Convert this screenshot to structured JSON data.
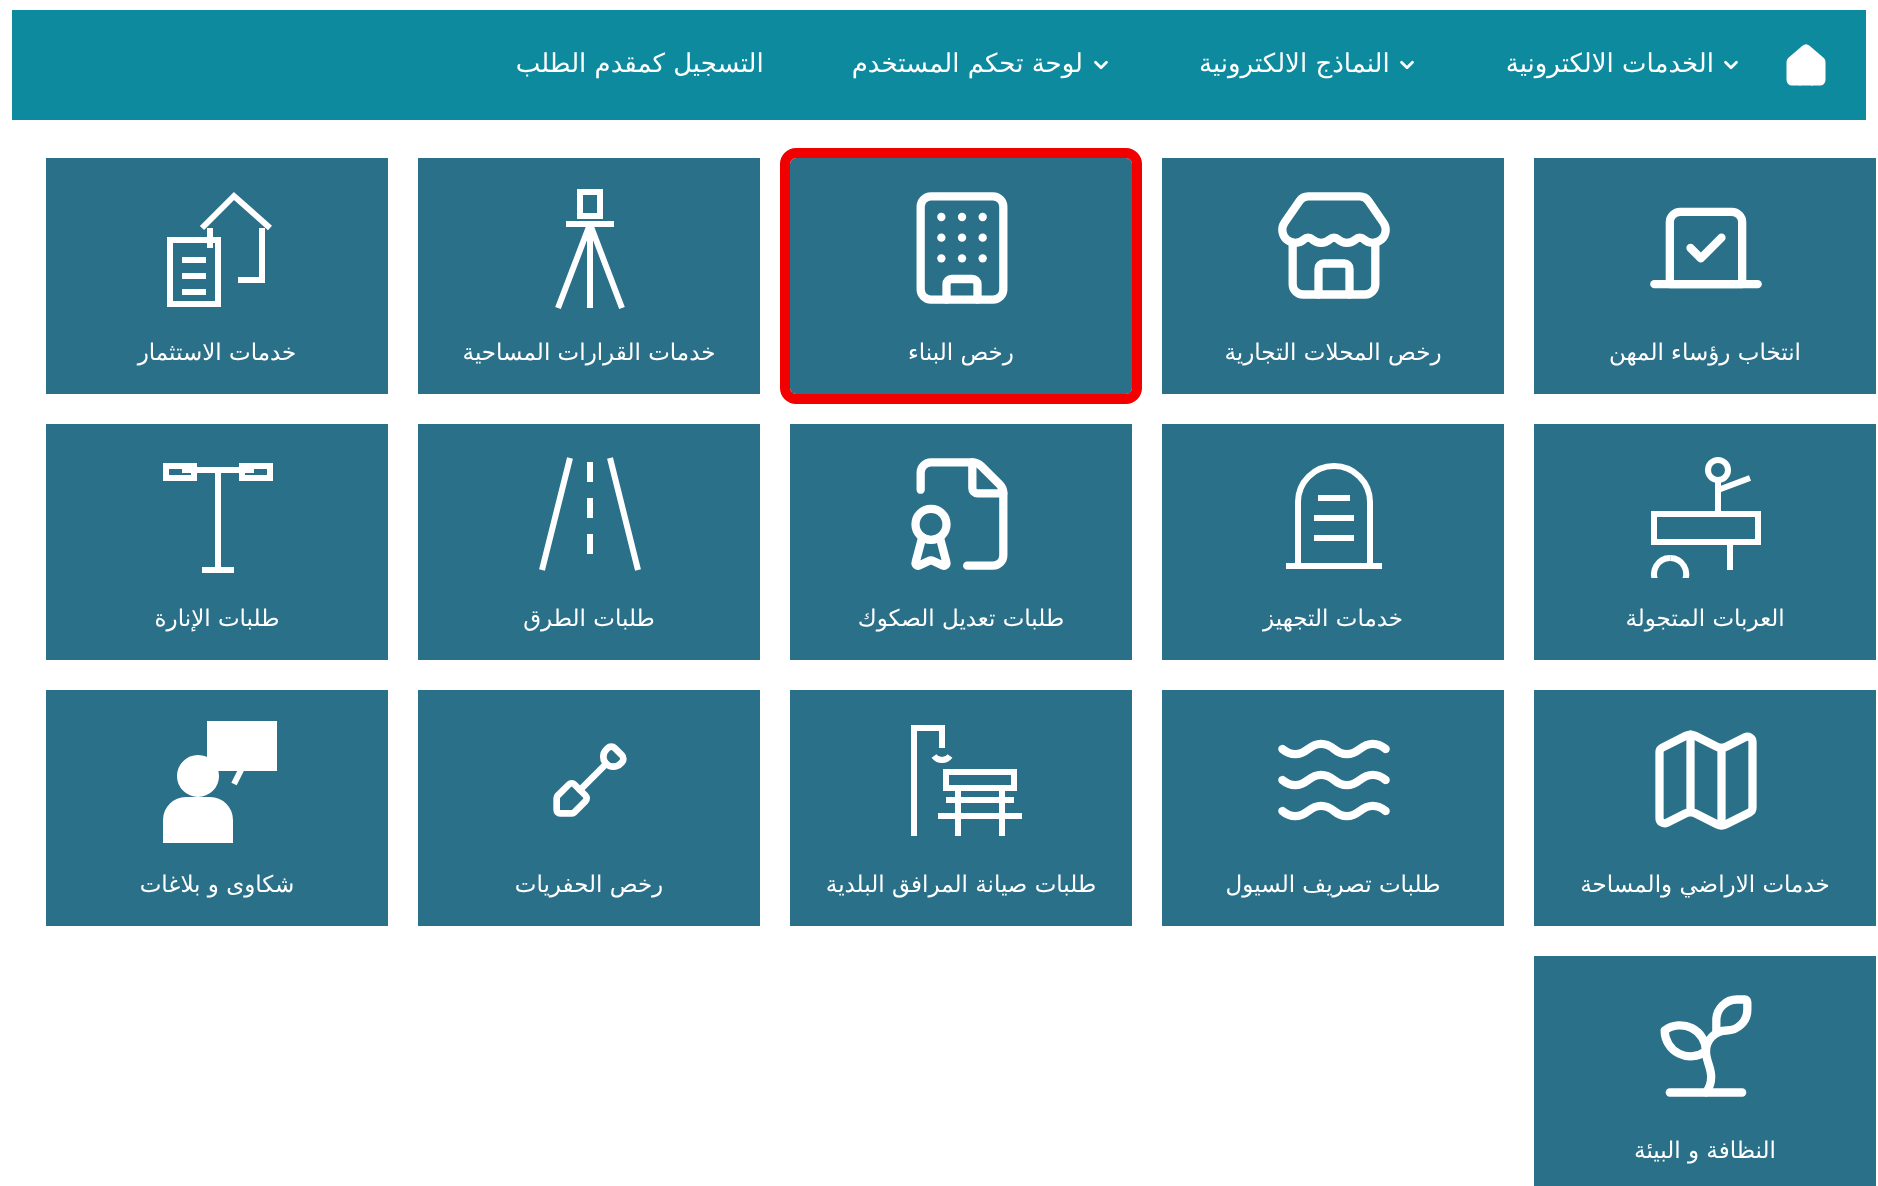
{
  "navbar": {
    "items": [
      {
        "label": "الخدمات الالكترونية",
        "dropdown": true
      },
      {
        "label": "النماذج الالكترونية",
        "dropdown": true
      },
      {
        "label": "لوحة تحكم المستخدم",
        "dropdown": true
      },
      {
        "label": "التسجيل كمقدم الطلب",
        "dropdown": false
      }
    ]
  },
  "services": [
    {
      "label": "انتخاب رؤساء المهن",
      "kind": "ballot",
      "selected": false
    },
    {
      "label": "رخص المحلات التجارية",
      "kind": "store",
      "selected": false
    },
    {
      "label": "رخص البناء",
      "kind": "building",
      "selected": true
    },
    {
      "label": "خدمات القرارات المساحية",
      "kind": "tripod",
      "selected": false
    },
    {
      "label": "خدمات الاستثمار",
      "kind": "docs",
      "selected": false
    },
    {
      "label": "العربات المتجولة",
      "kind": "cart",
      "selected": false
    },
    {
      "label": "خدمات التجهيز",
      "kind": "tomb",
      "selected": false
    },
    {
      "label": "طلبات تعديل الصكوك",
      "kind": "certificate",
      "selected": false
    },
    {
      "label": "طلبات الطرق",
      "kind": "road",
      "selected": false
    },
    {
      "label": "طلبات الإنارة",
      "kind": "lamp",
      "selected": false
    },
    {
      "label": "خدمات الاراضي والمساحة",
      "kind": "plan",
      "selected": false
    },
    {
      "label": "طلبات تصريف السيول",
      "kind": "waves",
      "selected": false
    },
    {
      "label": "طلبات صيانة المرافق البلدية",
      "kind": "bench",
      "selected": false
    },
    {
      "label": "رخص الحفريات",
      "kind": "digger",
      "selected": false
    },
    {
      "label": "شكاوى و بلاغات",
      "kind": "complaint",
      "selected": false
    },
    {
      "label": "النظافة و البيئة",
      "kind": "plant",
      "selected": false
    }
  ]
}
